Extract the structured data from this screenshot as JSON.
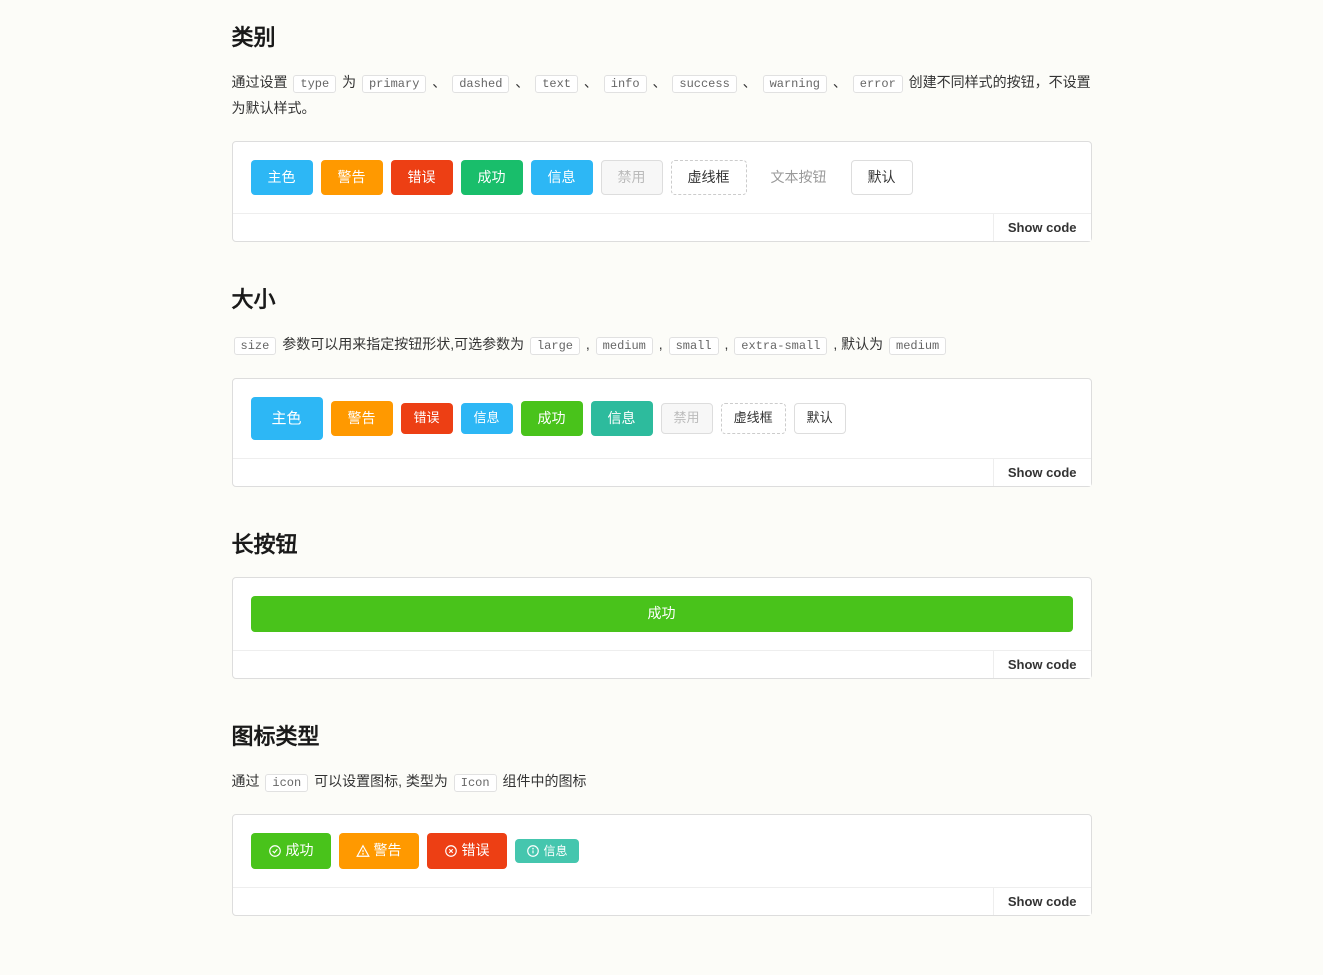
{
  "sections": {
    "type": {
      "title": "类别",
      "desc_parts": [
        "通过设置 ",
        "type",
        " 为 ",
        "primary",
        " 、 ",
        "dashed",
        " 、 ",
        "text",
        " 、 ",
        "info",
        " 、 ",
        "success",
        " 、 ",
        "warning",
        " 、 ",
        "error",
        " 创建不同样式的按钮，不设置为默认样式。"
      ],
      "buttons": [
        {
          "label": "主色",
          "cls": "btn-primary"
        },
        {
          "label": "警告",
          "cls": "btn-warning"
        },
        {
          "label": "错误",
          "cls": "btn-error"
        },
        {
          "label": "成功",
          "cls": "btn-success"
        },
        {
          "label": "信息",
          "cls": "btn-info"
        },
        {
          "label": "禁用",
          "cls": "btn-disabled"
        },
        {
          "label": "虚线框",
          "cls": "btn-dashed"
        },
        {
          "label": "文本按钮",
          "cls": "btn-text"
        },
        {
          "label": "默认",
          "cls": "btn-default"
        }
      ],
      "show_code": "Show code"
    },
    "size": {
      "title": "大小",
      "desc_parts": [
        "size",
        " 参数可以用来指定按钮形状,可选参数为 ",
        "large",
        " , ",
        "medium",
        " , ",
        "small",
        " , ",
        "extra-small",
        " , 默认为 ",
        "medium"
      ],
      "buttons": [
        {
          "label": "主色",
          "cls": "btn-primary btn-lg"
        },
        {
          "label": "警告",
          "cls": "btn-warning"
        },
        {
          "label": "错误",
          "cls": "btn-error btn-sm"
        },
        {
          "label": "信息",
          "cls": "btn-info btn-sm"
        },
        {
          "label": "成功",
          "cls": "btn-success-strong"
        },
        {
          "label": "信息",
          "cls": "btn-info-teal"
        },
        {
          "label": "禁用",
          "cls": "btn-disabled btn-sm"
        },
        {
          "label": "虚线框",
          "cls": "btn-dashed btn-sm"
        },
        {
          "label": "默认",
          "cls": "btn-default btn-sm"
        }
      ],
      "show_code": "Show code"
    },
    "long": {
      "title": "长按钮",
      "buttons": [
        {
          "label": "成功",
          "cls": "btn-success-strong btn-long"
        }
      ],
      "show_code": "Show code"
    },
    "icon": {
      "title": "图标类型",
      "desc_parts": [
        "通过 ",
        "icon",
        " 可以设置图标, 类型为 ",
        "Icon",
        " 组件中的图标"
      ],
      "buttons": [
        {
          "label": "成功",
          "cls": "btn-success-strong",
          "icon": "check-circle"
        },
        {
          "label": "警告",
          "cls": "btn-warning",
          "icon": "alert-triangle"
        },
        {
          "label": "错误",
          "cls": "btn-error",
          "icon": "x-circle"
        },
        {
          "label": "信息",
          "cls": "btn-info-light btn-xs",
          "icon": "info-circle"
        }
      ],
      "show_code": "Show code"
    }
  }
}
